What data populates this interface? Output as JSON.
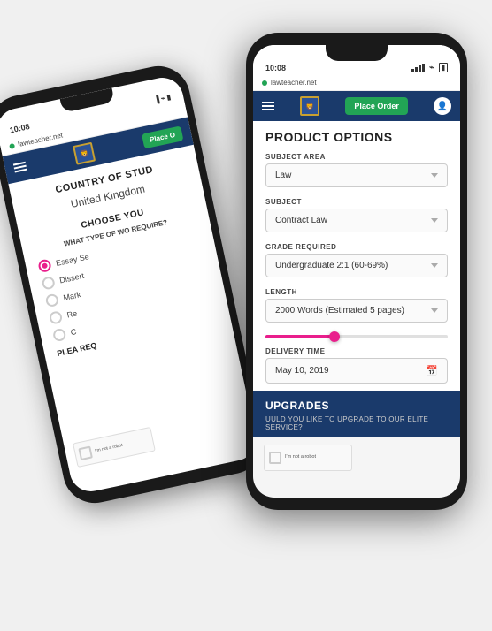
{
  "scene": {
    "background": "#f0f0f0"
  },
  "back_phone": {
    "status_time": "10:08",
    "url": "lawteacher.net",
    "nav": {
      "place_order": "Place O"
    },
    "country_section": {
      "title": "COUNTRY OF STUD",
      "value": "United Kingdom"
    },
    "choose_section": {
      "title": "CHOOSE YOU",
      "subtitle": "WHAT TYPE OF WO REQUIRE?",
      "options": [
        {
          "label": "Essay Se",
          "selected": true
        },
        {
          "label": "Dissert",
          "selected": false
        },
        {
          "label": "Mark",
          "selected": false
        },
        {
          "label": "Re",
          "selected": false
        },
        {
          "label": "C",
          "selected": false
        }
      ]
    },
    "please_section": "PLEA REQ"
  },
  "front_phone": {
    "status_time": "10:08",
    "url": "lawteacher.net",
    "nav": {
      "place_order": "Place Order",
      "user_icon": "👤"
    },
    "product_options": {
      "title": "PRODUCT OPTIONS",
      "subject_area_label": "SUBJECT AREA",
      "subject_area_value": "Law",
      "subject_label": "SUBJECT",
      "subject_value": "Contract Law",
      "grade_label": "GRADE REQUIRED",
      "grade_value": "Undergraduate 2:1 (60-69%)",
      "length_label": "LENGTH",
      "length_value": "2000 Words (Estimated 5 pages)",
      "delivery_label": "DELIVERY TIME",
      "delivery_value": "May 10, 2019"
    },
    "upgrades": {
      "title": "UPGRADES",
      "subtitle": "UULD YOU LIKE TO UPGRADE TO OUR ELITE SERVICE?"
    }
  }
}
